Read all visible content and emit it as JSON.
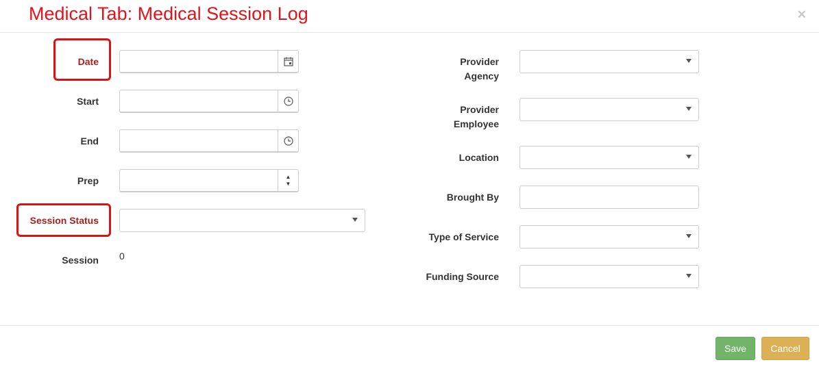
{
  "modal": {
    "title": "Medical Tab: Medical Session Log",
    "close_icon": "close-icon"
  },
  "left_form": {
    "date_label": "Date",
    "start_label": "Start",
    "end_label": "End",
    "prep_label": "Prep",
    "session_status_label": "Session Status",
    "session_label": "Session",
    "session_value": "0",
    "date_value": "",
    "start_value": "",
    "end_value": "",
    "prep_value": "",
    "session_status_value": ""
  },
  "right_form": {
    "provider_agency_label_line1": "Provider",
    "provider_agency_label_line2": "Agency",
    "provider_employee_label_line1": "Provider",
    "provider_employee_label_line2": "Employee",
    "location_label": "Location",
    "brought_by_label": "Brought By",
    "type_of_service_label": "Type of Service",
    "funding_source_label": "Funding Source",
    "brought_by_value": ""
  },
  "footer": {
    "save_label": "Save",
    "cancel_label": "Cancel"
  },
  "colors": {
    "title": "#e2141b",
    "required_label": "#a81f1f",
    "highlight": "#e01010",
    "save": "#72b56a",
    "cancel": "#dcb156"
  },
  "icons": {
    "date": "calendar-icon",
    "time": "clock-icon",
    "spinner": "spinner-arrows-icon",
    "dropdown": "chevron-down-icon"
  }
}
